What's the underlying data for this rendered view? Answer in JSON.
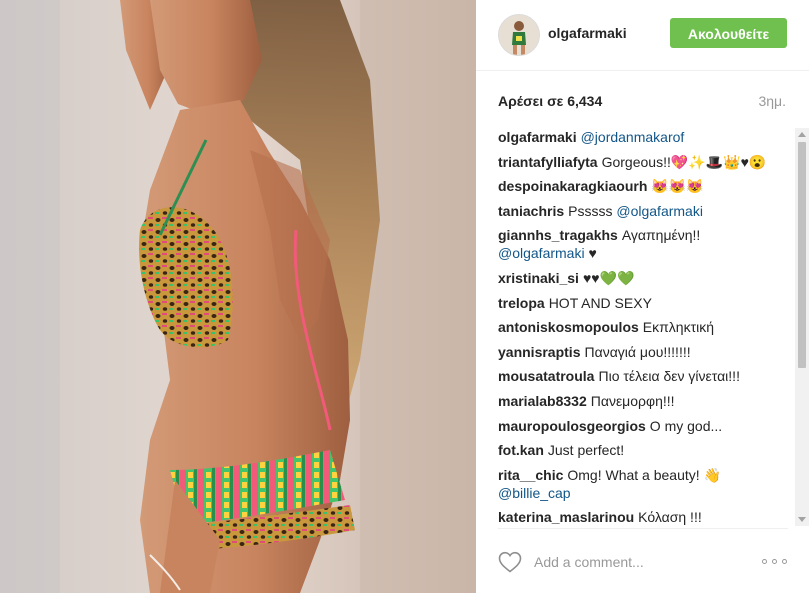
{
  "post": {
    "image_alt": "",
    "username": "olgafarmaki",
    "follow_label": "Ακολουθείτε",
    "likes_text": "Αρέσει σε 6,434",
    "time_ago": "3ημ."
  },
  "comments": [
    {
      "user": "olgafarmaki",
      "text": "",
      "mention": "@jordanmakarof"
    },
    {
      "user": "triantafylliafyta",
      "text": "Gorgeous!!💖✨🎩👑♥😮",
      "mention": ""
    },
    {
      "user": "despoinakaragkiaourh",
      "text": "😻😻😻",
      "mention": ""
    },
    {
      "user": "taniachris",
      "text": "Psssss",
      "mention": "@olgafarmaki"
    },
    {
      "user": "giannhs_tragakhs",
      "text": "Αγαπημένη!!",
      "mention": "@olgafarmaki",
      "after": "♥"
    },
    {
      "user": "xristinaki_si",
      "text": "♥♥💚💚",
      "mention": ""
    },
    {
      "user": "trelopa",
      "text": "HOT AND SEXY",
      "mention": ""
    },
    {
      "user": "antoniskosmopoulos",
      "text": "Εκπληκτική",
      "mention": ""
    },
    {
      "user": "yannisraptis",
      "text": "Παναγιά μου!!!!!!!",
      "mention": ""
    },
    {
      "user": "mousatatroula",
      "text": "Πιο τέλεια δεν γίνεται!!!",
      "mention": ""
    },
    {
      "user": "marialab8332",
      "text": "Πανεμορφη!!!",
      "mention": ""
    },
    {
      "user": "mauropoulosgeorgios",
      "text": "O my god...",
      "mention": ""
    },
    {
      "user": "fot.kan",
      "text": "Just perfect!",
      "mention": ""
    },
    {
      "user": "rita__chic",
      "text": "Omg! What a beauty! 👋",
      "mention": "@billie_cap"
    },
    {
      "user": "katerina_maslarinou",
      "text": "Κόλαση !!!",
      "mention": ""
    }
  ],
  "footer": {
    "comment_placeholder": "Add a comment..."
  },
  "icons": {
    "heart": "heart-outline-icon",
    "more": "more-options-icon"
  },
  "colors": {
    "follow_button": "#70c050",
    "mention": "#125688",
    "username": "#262626",
    "muted": "#999999"
  }
}
